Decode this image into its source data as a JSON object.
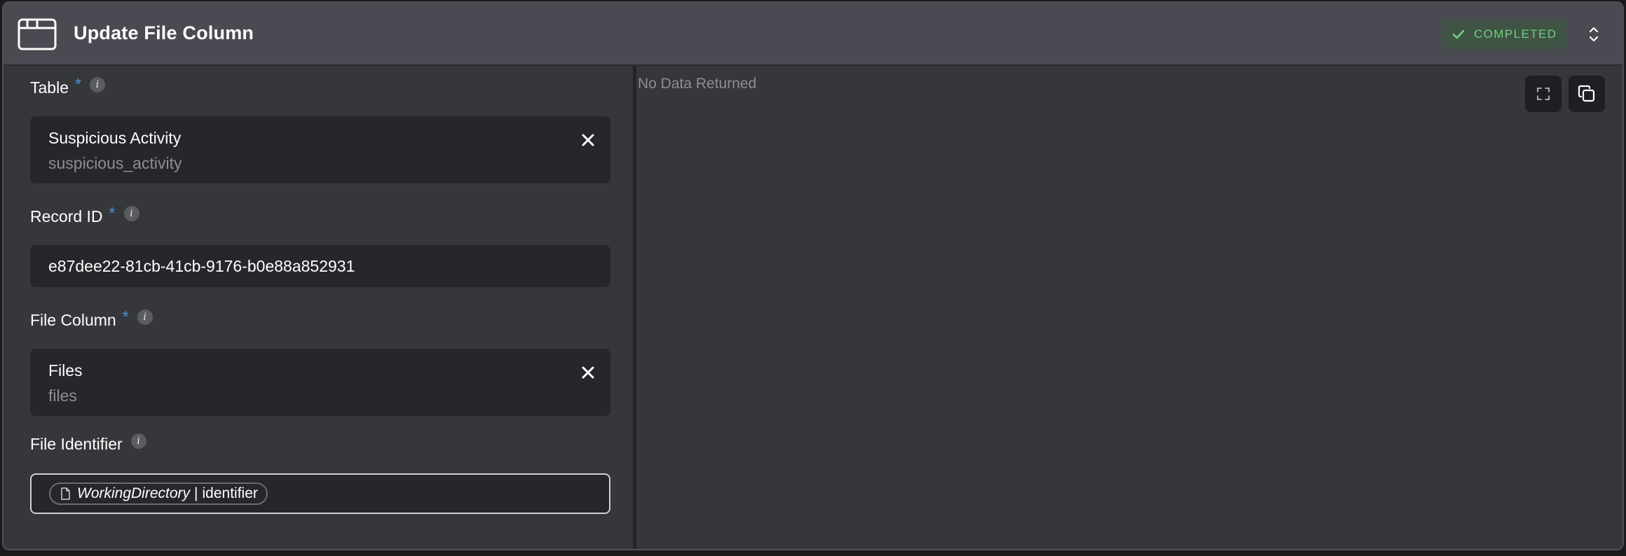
{
  "header": {
    "title": "Update File Column",
    "status": "COMPLETED",
    "app_icon": "browser-window-icon",
    "status_icon": "check-icon",
    "toggle_icon": "chevron-up-down-icon"
  },
  "form": {
    "table": {
      "label": "Table",
      "required_mark": "*",
      "info": "i",
      "selected_name": "Suspicious Activity",
      "selected_key": "suspicious_activity"
    },
    "record_id": {
      "label": "Record ID",
      "required_mark": "*",
      "info": "i",
      "value": "e87dee22-81cb-41cb-9176-b0e88a852931"
    },
    "file_column": {
      "label": "File Column",
      "required_mark": "*",
      "info": "i",
      "selected_name": "Files",
      "selected_key": "files"
    },
    "file_identifier": {
      "label": "File Identifier",
      "info": "i",
      "token_variable": "WorkingDirectory",
      "token_separator": "|",
      "token_field": "identifier"
    }
  },
  "output": {
    "empty_text": "No Data Returned",
    "fullscreen_icon": "fullscreen-icon",
    "copy_icon": "copy-icon"
  },
  "colors": {
    "panel_bg": "#36373b",
    "header_bg": "#4a4b52",
    "input_bg": "#26272b",
    "accent_blue": "#4a90e2",
    "status_green": "#6fd07d",
    "status_bg": "#3f5445"
  }
}
